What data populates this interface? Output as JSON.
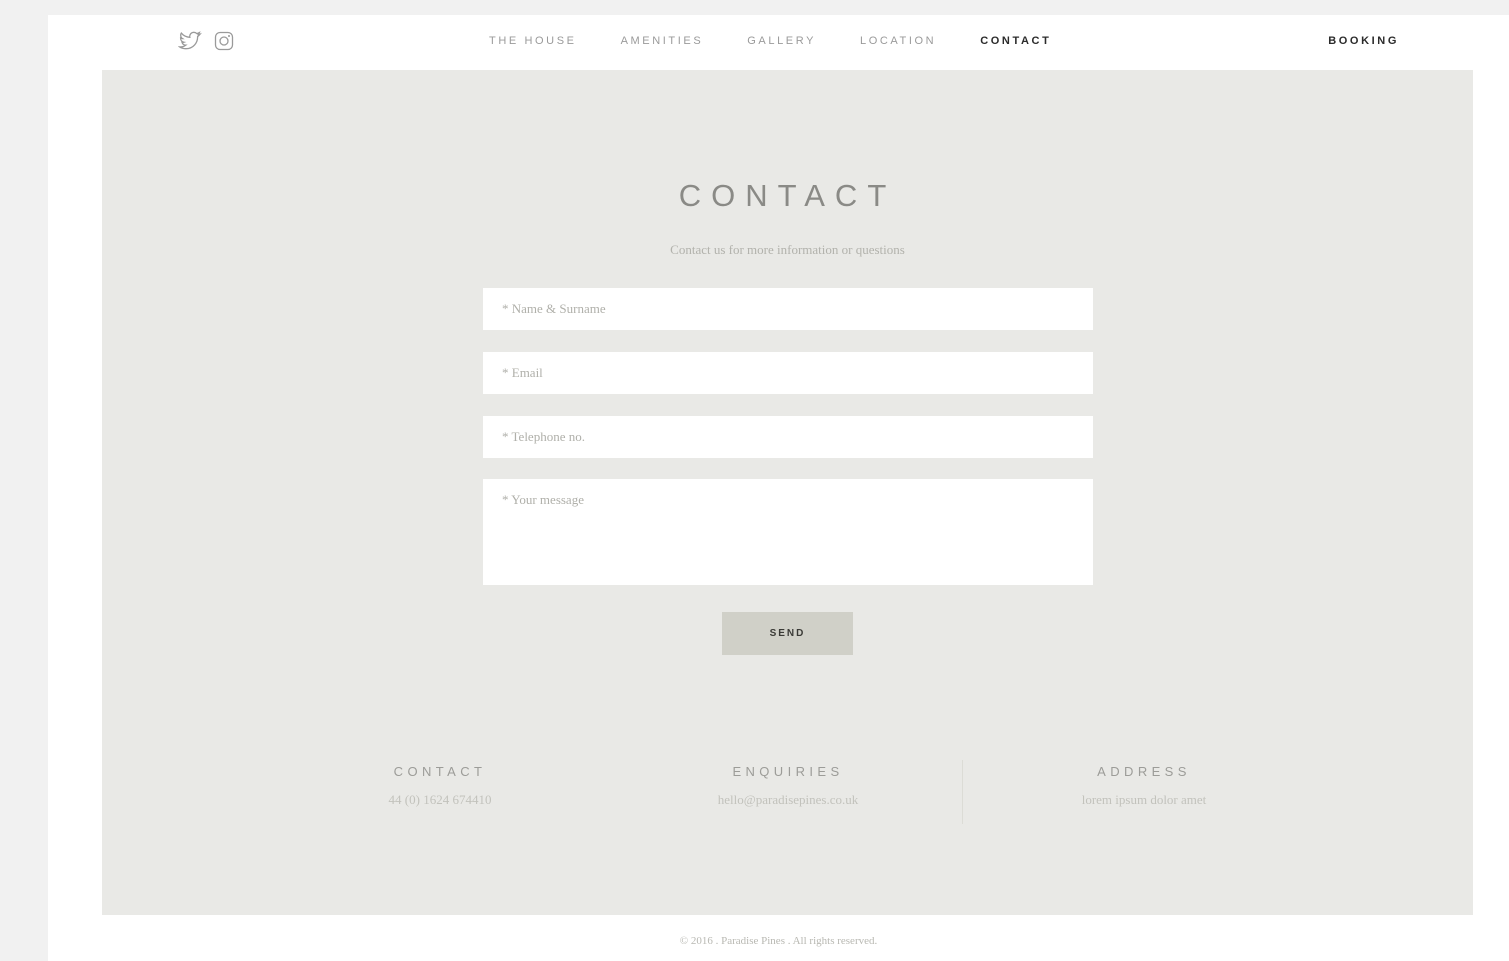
{
  "header": {
    "social_icons": [
      "twitter-icon",
      "instagram-icon"
    ],
    "nav": [
      {
        "label": "THE HOUSE"
      },
      {
        "label": "AMENITIES"
      },
      {
        "label": "GALLERY"
      },
      {
        "label": "LOCATION"
      },
      {
        "label": "CONTACT"
      }
    ],
    "active_nav": "CONTACT",
    "booking_label": "BOOKING"
  },
  "main": {
    "title": "CONTACT",
    "subtitle": "Contact us for more information or questions",
    "form": {
      "name_placeholder": "* Name & Surname",
      "email_placeholder": "* Email",
      "telephone_placeholder": "* Telephone no.",
      "message_placeholder": "* Your message",
      "send_label": "SEND"
    }
  },
  "info": {
    "contact": {
      "label": "CONTACT",
      "value": "44 (0) 1624 674410"
    },
    "enquiries": {
      "label": "ENQUIRIES",
      "value": "hello@paradisepines.co.uk"
    },
    "address": {
      "label": "ADDRESS",
      "value": "lorem ipsum dolor amet"
    }
  },
  "footer": {
    "copyright": "© 2016 . Paradise Pines . All rights reserved."
  },
  "colors": {
    "panel_bg": "#e9e9e6",
    "button_bg": "#d0d0c8",
    "nav_active": "#2b2b2b"
  }
}
